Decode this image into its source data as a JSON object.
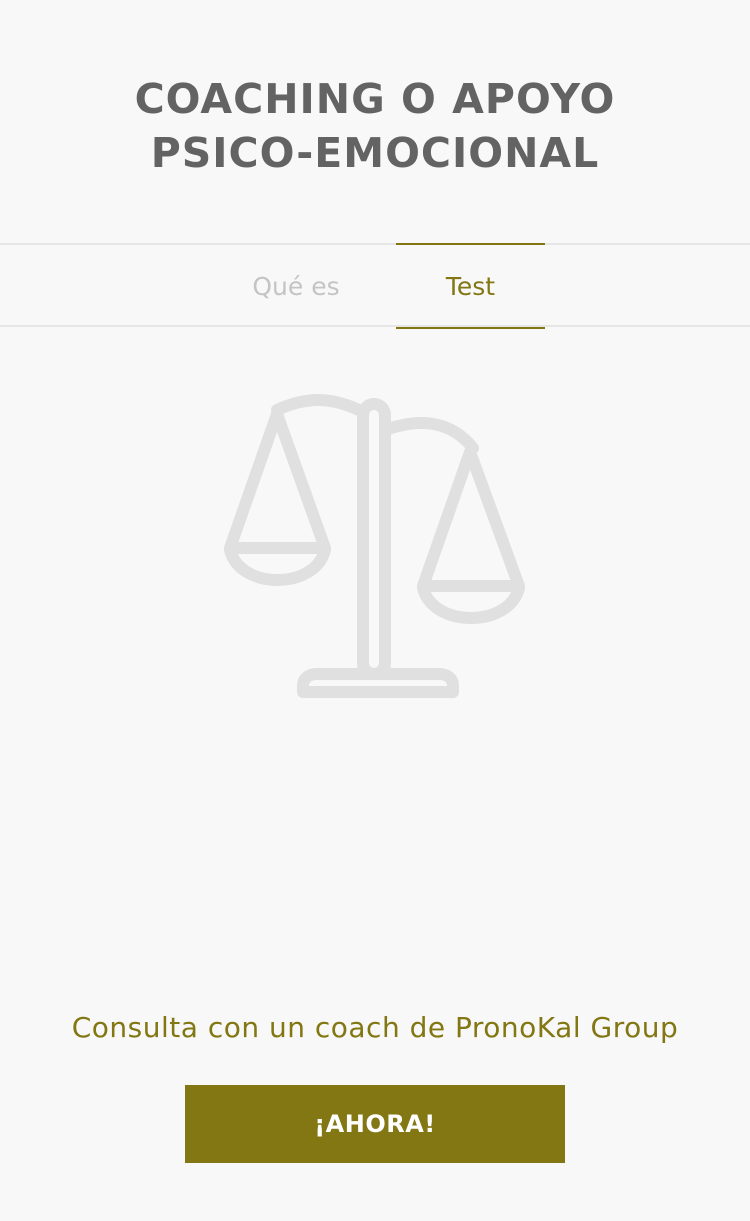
{
  "header": {
    "title_line1": "COACHING O APOYO",
    "title_line2": "PSICO-EMOCIONAL"
  },
  "tabs": [
    {
      "label": "Qué es",
      "active": false
    },
    {
      "label": "Test",
      "active": true
    }
  ],
  "illustration": {
    "icon": "balance-scale-icon",
    "color": "#e0e0e0"
  },
  "cta": {
    "text": "Consulta con un coach de PronoKal Group",
    "button_label": "¡AHORA!"
  },
  "colors": {
    "accent": "#827712",
    "title": "#636363",
    "inactive_tab": "#c4c4c4",
    "background": "#f8f8f8"
  }
}
